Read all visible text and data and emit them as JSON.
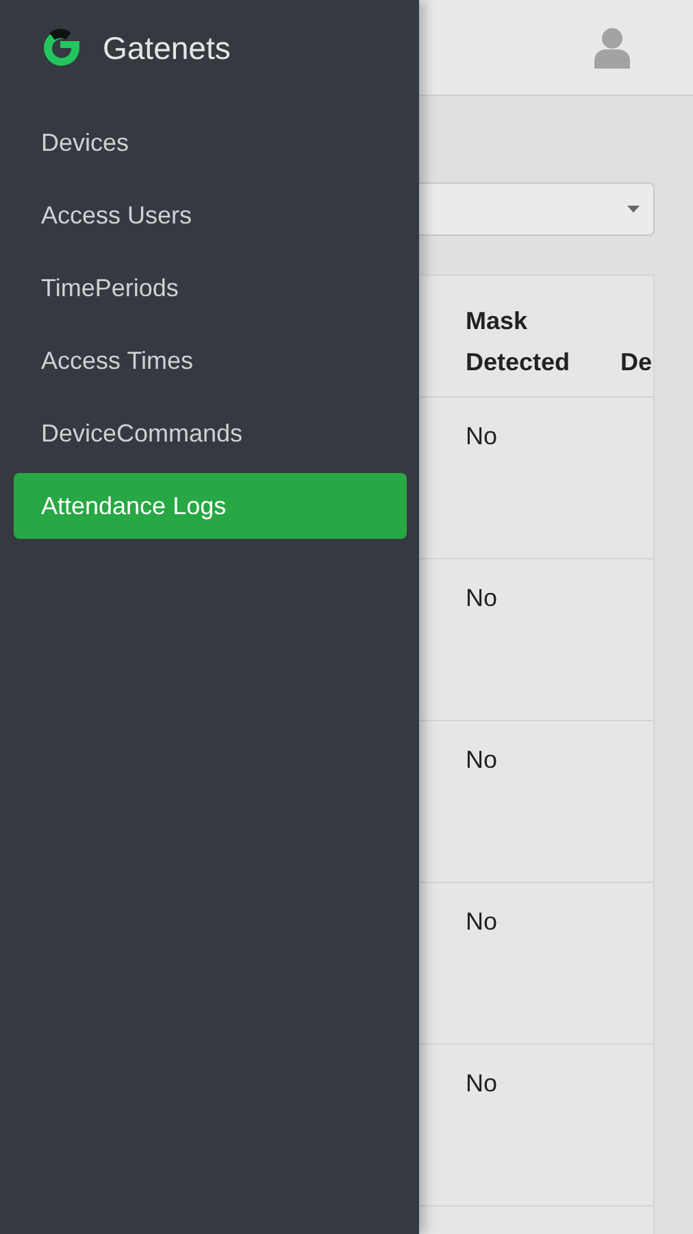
{
  "sidebar": {
    "brand": "Gatenets",
    "items": [
      {
        "label": "Devices",
        "selected": false
      },
      {
        "label": "Access Users",
        "selected": false
      },
      {
        "label": "TimePeriods",
        "selected": false
      },
      {
        "label": "Access Times",
        "selected": false
      },
      {
        "label": "DeviceCommands",
        "selected": false
      },
      {
        "label": "Attendance Logs",
        "selected": true
      }
    ]
  },
  "table": {
    "columns": [
      "Mask Detected",
      "De"
    ],
    "rows": [
      {
        "mask_detected": "No"
      },
      {
        "mask_detected": "No"
      },
      {
        "mask_detected": "No"
      },
      {
        "mask_detected": "No"
      },
      {
        "mask_detected": "No"
      }
    ]
  }
}
